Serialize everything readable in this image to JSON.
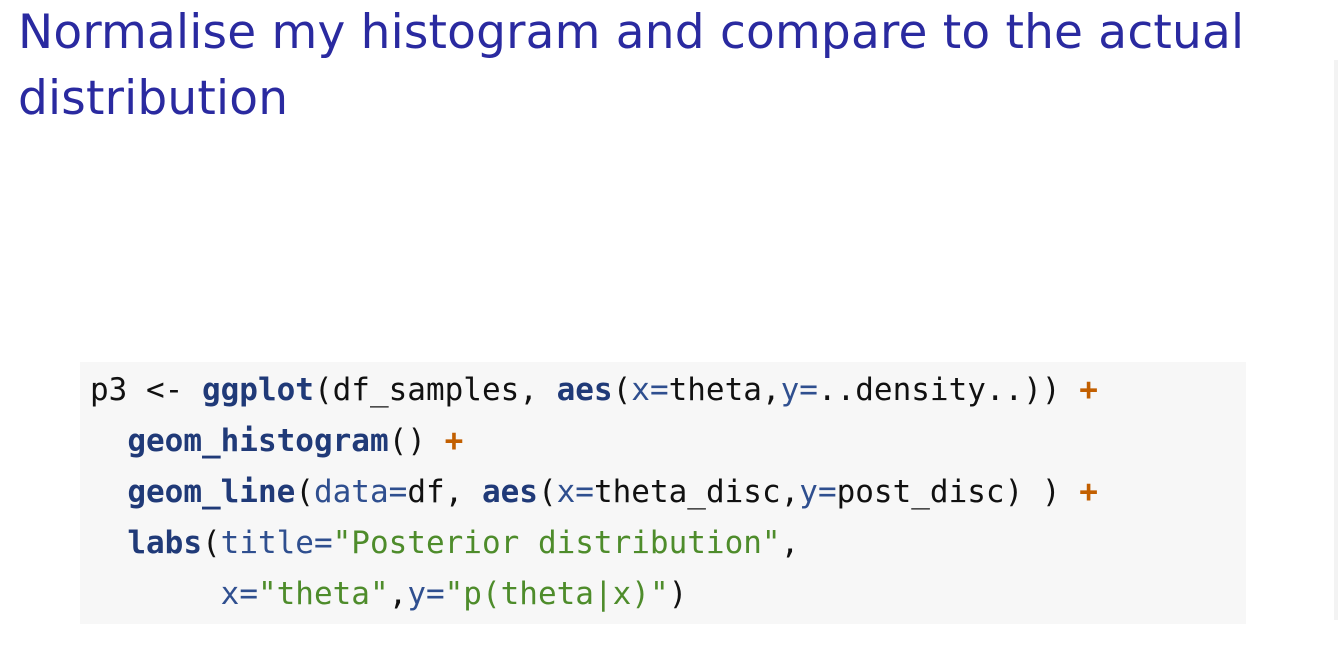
{
  "slide": {
    "title": "Normalise my histogram and compare to the actual distribution"
  },
  "code": {
    "lines": [
      [
        {
          "t": "p3 <- ",
          "c": "plain"
        },
        {
          "t": "ggplot",
          "c": "fn"
        },
        {
          "t": "(df_samples, ",
          "c": "plain"
        },
        {
          "t": "aes",
          "c": "fn"
        },
        {
          "t": "(",
          "c": "plain"
        },
        {
          "t": "x=",
          "c": "arg"
        },
        {
          "t": "theta,",
          "c": "plain"
        },
        {
          "t": "y=",
          "c": "arg"
        },
        {
          "t": "..density..)) ",
          "c": "plain"
        },
        {
          "t": "+",
          "c": "op"
        }
      ],
      [
        {
          "t": "  ",
          "c": "plain"
        },
        {
          "t": "geom_histogram",
          "c": "fn"
        },
        {
          "t": "() ",
          "c": "plain"
        },
        {
          "t": "+",
          "c": "op"
        }
      ],
      [
        {
          "t": "  ",
          "c": "plain"
        },
        {
          "t": "geom_line",
          "c": "fn"
        },
        {
          "t": "(",
          "c": "plain"
        },
        {
          "t": "data=",
          "c": "arg"
        },
        {
          "t": "df, ",
          "c": "plain"
        },
        {
          "t": "aes",
          "c": "fn"
        },
        {
          "t": "(",
          "c": "plain"
        },
        {
          "t": "x=",
          "c": "arg"
        },
        {
          "t": "theta_disc,",
          "c": "plain"
        },
        {
          "t": "y=",
          "c": "arg"
        },
        {
          "t": "post_disc) ) ",
          "c": "plain"
        },
        {
          "t": "+",
          "c": "op"
        }
      ],
      [
        {
          "t": "  ",
          "c": "plain"
        },
        {
          "t": "labs",
          "c": "fn"
        },
        {
          "t": "(",
          "c": "plain"
        },
        {
          "t": "title=",
          "c": "arg"
        },
        {
          "t": "\"Posterior distribution\"",
          "c": "str"
        },
        {
          "t": ",",
          "c": "plain"
        }
      ],
      [
        {
          "t": "       ",
          "c": "plain"
        },
        {
          "t": "x=",
          "c": "arg"
        },
        {
          "t": "\"theta\"",
          "c": "str"
        },
        {
          "t": ",",
          "c": "plain"
        },
        {
          "t": "y=",
          "c": "arg"
        },
        {
          "t": "\"p(theta|x)\"",
          "c": "str"
        },
        {
          "t": ")",
          "c": "plain"
        }
      ]
    ]
  }
}
